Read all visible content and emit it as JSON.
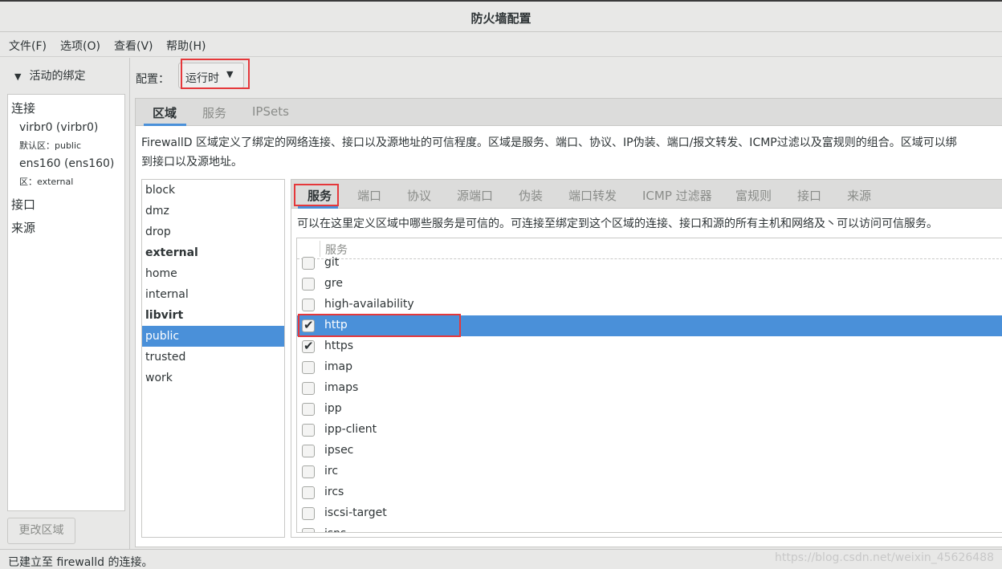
{
  "window": {
    "title": "防火墙配置"
  },
  "menubar": [
    "文件(F)",
    "选项(O)",
    "查看(V)",
    "帮助(H)"
  ],
  "bindings": {
    "expander_label": "活动的绑定",
    "connections_header": "连接",
    "connections": [
      {
        "name": "virbr0 (virbr0)",
        "zone": "默认区：public"
      },
      {
        "name": "ens160 (ens160)",
        "zone": "区：external"
      }
    ],
    "interfaces_header": "接口",
    "sources_header": "来源",
    "change_zone_button": "更改区域"
  },
  "config": {
    "label": "配置：",
    "value": "运行时"
  },
  "main_tabs": [
    "区域",
    "服务",
    "IPSets"
  ],
  "zone_description_line1": "FirewallD 区域定义了绑定的网络连接、接口以及源地址的可信程度。区域是服务、端口、协议、IP伪装、端口/报文转发、ICMP过滤以及富规则的组合。区域可以绑",
  "zone_description_line2": "到接口以及源地址。",
  "zones": [
    {
      "name": "block",
      "bold": false,
      "selected": false
    },
    {
      "name": "dmz",
      "bold": false,
      "selected": false
    },
    {
      "name": "drop",
      "bold": false,
      "selected": false
    },
    {
      "name": "external",
      "bold": true,
      "selected": false
    },
    {
      "name": "home",
      "bold": false,
      "selected": false
    },
    {
      "name": "internal",
      "bold": false,
      "selected": false
    },
    {
      "name": "libvirt",
      "bold": true,
      "selected": false
    },
    {
      "name": "public",
      "bold": false,
      "selected": true
    },
    {
      "name": "trusted",
      "bold": false,
      "selected": false
    },
    {
      "name": "work",
      "bold": false,
      "selected": false
    }
  ],
  "sub_tabs": [
    "服务",
    "端口",
    "协议",
    "源端口",
    "伪装",
    "端口转发",
    "ICMP 过滤器",
    "富规则",
    "接口",
    "来源"
  ],
  "services_description": "可以在这里定义区域中哪些服务是可信的。可连接至绑定到这个区域的连接、接口和源的所有主机和网络及丶可以访问可信服务。",
  "services_column_header": "服务",
  "services": [
    {
      "name": "git",
      "checked": false,
      "selected": false
    },
    {
      "name": "gre",
      "checked": false,
      "selected": false
    },
    {
      "name": "high-availability",
      "checked": false,
      "selected": false
    },
    {
      "name": "http",
      "checked": true,
      "selected": true
    },
    {
      "name": "https",
      "checked": true,
      "selected": false
    },
    {
      "name": "imap",
      "checked": false,
      "selected": false
    },
    {
      "name": "imaps",
      "checked": false,
      "selected": false
    },
    {
      "name": "ipp",
      "checked": false,
      "selected": false
    },
    {
      "name": "ipp-client",
      "checked": false,
      "selected": false
    },
    {
      "name": "ipsec",
      "checked": false,
      "selected": false
    },
    {
      "name": "irc",
      "checked": false,
      "selected": false
    },
    {
      "name": "ircs",
      "checked": false,
      "selected": false
    },
    {
      "name": "iscsi-target",
      "checked": false,
      "selected": false
    },
    {
      "name": "isns",
      "checked": false,
      "selected": false
    }
  ],
  "status": {
    "text": "已建立至 firewalld 的连接。",
    "watermark": "https://blog.csdn.net/weixin_45626488"
  },
  "colors": {
    "selection": "#4a90d9",
    "highlight_box": "#e5383b"
  }
}
